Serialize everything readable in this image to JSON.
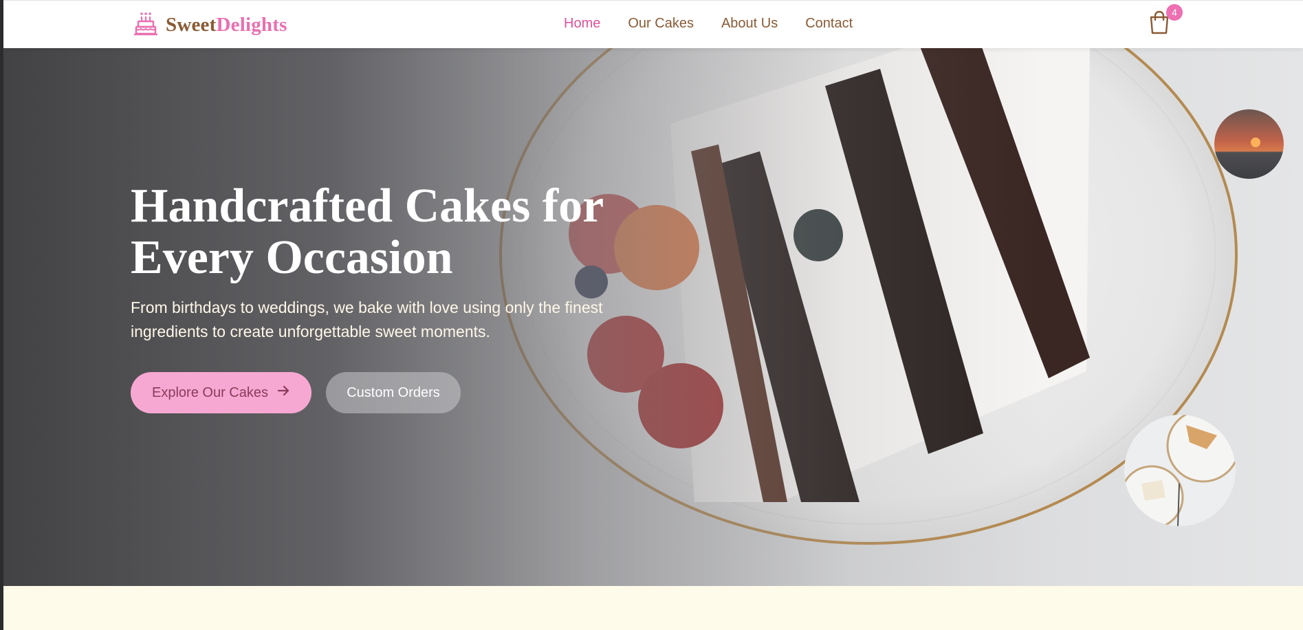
{
  "brand": {
    "name_part1": "Sweet",
    "name_part2": "Delights",
    "logo_icon": "birthday-cake-icon"
  },
  "nav": {
    "items": [
      {
        "label": "Home",
        "active": true
      },
      {
        "label": "Our Cakes",
        "active": false
      },
      {
        "label": "About Us",
        "active": false
      },
      {
        "label": "Contact",
        "active": false
      }
    ]
  },
  "cart": {
    "icon": "shopping-bag-icon",
    "count": "4"
  },
  "hero": {
    "title": "Handcrafted Cakes for Every Occasion",
    "subtitle": "From birthdays to weddings, we bake with love using only the finest ingredients to create unforgettable sweet moments.",
    "primary_button": "Explore Our Cakes",
    "primary_button_icon": "arrow-right-icon",
    "secondary_button": "Custom Orders"
  },
  "colors": {
    "accent_pink": "#e0529a",
    "brand_brown": "#8a5a34",
    "button_pink": "#f7a8d2",
    "cream": "#fefbea"
  }
}
